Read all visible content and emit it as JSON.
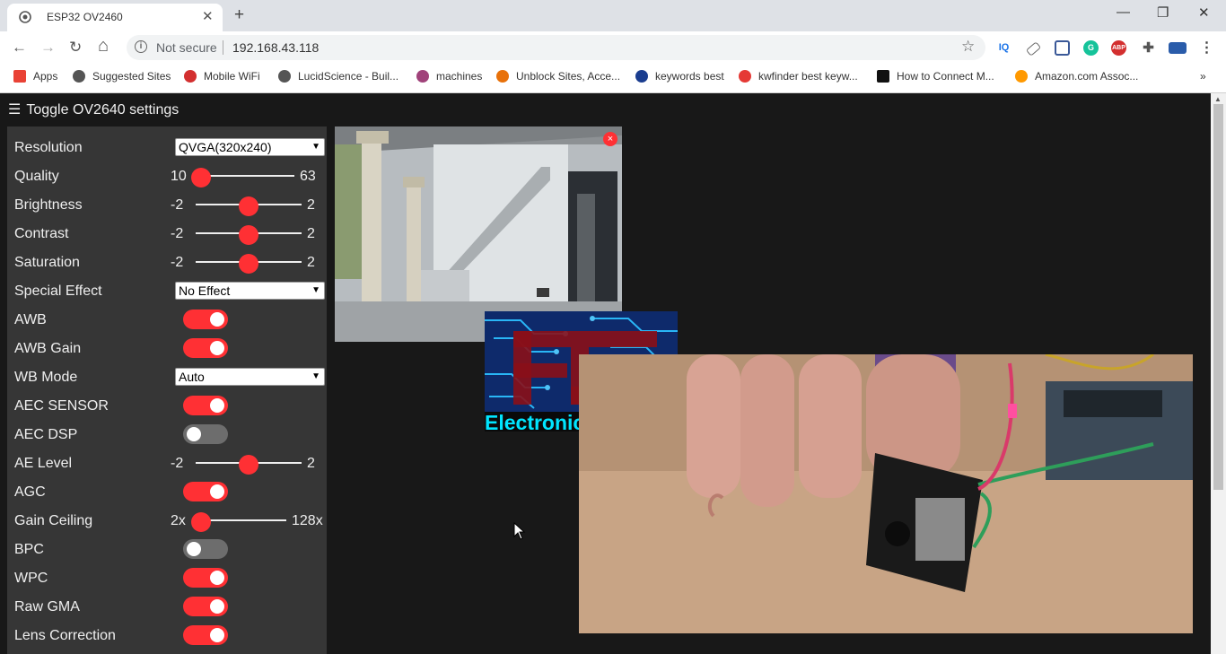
{
  "browser": {
    "tab_title": "ESP32 OV2460",
    "tab_close": "✕",
    "new_tab": "+",
    "window_buttons": {
      "minimize": "—",
      "restore": "❐",
      "close": "✕"
    },
    "nav": {
      "back": "←",
      "forward": "→",
      "reload": "↻",
      "home": "⌂"
    },
    "security_label": "Not secure",
    "url": "192.168.43.118",
    "star": "☆",
    "extensions": [
      "IQ",
      "tag-icon",
      "square-icon",
      "G",
      "ABP",
      "puzzle-icon",
      "card-icon"
    ],
    "menu": "⋮"
  },
  "bookmarks": {
    "items": [
      {
        "label": "Apps",
        "icon": "apps-grid-icon",
        "color": "#e94235"
      },
      {
        "label": "Suggested Sites",
        "icon": "globe-icon",
        "color": "#555555"
      },
      {
        "label": "Mobile WiFi",
        "icon": "huawei-icon",
        "color": "#d32f2f"
      },
      {
        "label": "LucidScience - Buil...",
        "icon": "globe-icon",
        "color": "#555555"
      },
      {
        "label": "machines",
        "icon": "machines-icon",
        "color": "#a0427a"
      },
      {
        "label": "Unblock Sites, Acce...",
        "icon": "unblock-icon",
        "color": "#e8710a"
      },
      {
        "label": "keywords best",
        "icon": "plane-icon",
        "color": "#1a3d8f"
      },
      {
        "label": "kwfinder best keyw...",
        "icon": "kwfinder-icon",
        "color": "#e53935"
      },
      {
        "label": "How to Connect M...",
        "icon": "l-icon",
        "color": "#111111"
      },
      {
        "label": "Amazon.com Assoc...",
        "icon": "amazon-icon",
        "color": "#ff9900"
      }
    ],
    "overflow": "»"
  },
  "page": {
    "toggle_label": "Toggle OV2640 settings",
    "hamburger": "☰",
    "accent_color": "#ff3034",
    "settings": [
      {
        "label": "Resolution",
        "type": "select",
        "value": "QVGA(320x240)"
      },
      {
        "label": "Quality",
        "type": "slider",
        "min": "10",
        "max": "63",
        "fraction": 0.0
      },
      {
        "label": "Brightness",
        "type": "slider",
        "min": "-2",
        "max": "2",
        "fraction": 0.5
      },
      {
        "label": "Contrast",
        "type": "slider",
        "min": "-2",
        "max": "2",
        "fraction": 0.5
      },
      {
        "label": "Saturation",
        "type": "slider",
        "min": "-2",
        "max": "2",
        "fraction": 0.5
      },
      {
        "label": "Special Effect",
        "type": "select",
        "value": "No Effect"
      },
      {
        "label": "AWB",
        "type": "toggle",
        "on": true
      },
      {
        "label": "AWB Gain",
        "type": "toggle",
        "on": true
      },
      {
        "label": "WB Mode",
        "type": "select",
        "value": "Auto"
      },
      {
        "label": "AEC SENSOR",
        "type": "toggle",
        "on": true
      },
      {
        "label": "AEC DSP",
        "type": "toggle",
        "on": false
      },
      {
        "label": "AE Level",
        "type": "slider",
        "min": "-2",
        "max": "2",
        "fraction": 0.5
      },
      {
        "label": "AGC",
        "type": "toggle",
        "on": true
      },
      {
        "label": "Gain Ceiling",
        "type": "slider",
        "min": "2x",
        "max": "128x",
        "fraction": 0.0
      },
      {
        "label": "BPC",
        "type": "toggle",
        "on": false
      },
      {
        "label": "WPC",
        "type": "toggle",
        "on": true
      },
      {
        "label": "Raw GMA",
        "type": "toggle",
        "on": true
      },
      {
        "label": "Lens Correction",
        "type": "toggle",
        "on": true
      }
    ],
    "stream_close": "×"
  },
  "overlay": {
    "logo_text": "Electronic Clinic"
  }
}
